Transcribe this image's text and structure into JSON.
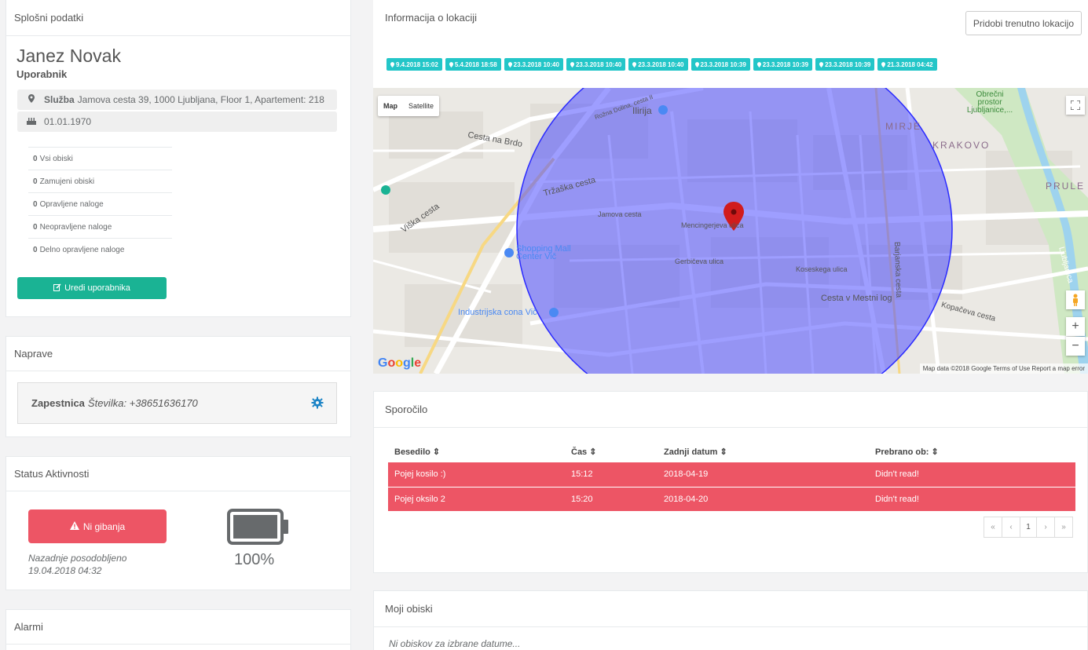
{
  "general": {
    "title": "Splošni podatki",
    "name": "Janez Novak",
    "role": "Uporabnik",
    "address_label": "Služba",
    "address": "Jamova cesta 39, 1000 Ljubljana, Floor 1, Apartement: 218",
    "birthdate": "01.01.1970",
    "stats": [
      {
        "count": "0",
        "label": "Vsi obiski"
      },
      {
        "count": "0",
        "label": "Zamujeni obiski"
      },
      {
        "count": "0",
        "label": "Opravljene naloge"
      },
      {
        "count": "0",
        "label": "Neopravljene naloge"
      },
      {
        "count": "0",
        "label": "Delno opravljene naloge"
      }
    ],
    "edit_button": "Uredi uporabnika"
  },
  "devices": {
    "title": "Naprave",
    "device_name": "Zapestnica",
    "device_number": "Številka: +38651636170"
  },
  "status": {
    "title": "Status Aktivnosti",
    "alarm_button": "Ni gibanja",
    "last_updated_label": "Nazadnje posodobljeno",
    "last_updated_time": "19.04.2018 04:32",
    "battery_percent": "100%",
    "battery_level": 1.0
  },
  "alarms": {
    "title": "Alarmi"
  },
  "location": {
    "title": "Informacija o lokaciji",
    "current_button": "Pridobi trenutno lokacijo",
    "tags": [
      "9.4.2018 15:02",
      "5.4.2018 18:58",
      "23.3.2018 10:40",
      "23.3.2018 10:40",
      "23.3.2018 10:40",
      "23.3.2018 10:39",
      "23.3.2018 10:39",
      "23.3.2018 10:39",
      "21.3.2018 04:42"
    ],
    "map": {
      "type_map": "Map",
      "type_satellite": "Satellite",
      "footer": "Map data ©2018 Google   Terms of Use   Report a map error",
      "labels": [
        "Ilirija",
        "Tržaška cesta",
        "Cesta na Brdo",
        "Jamova cesta",
        "Mencingerjeva ulica",
        "Gerbičeva ulica",
        "Koseskega ulica",
        "Cesta v Mestni log",
        "Shopping Mall Center Vič",
        "Industrijska cona Vič",
        "MIRJE",
        "KRAKOVO",
        "PRULE",
        "Viška cesta",
        "Barjanska cesta",
        "Kopačeva cesta",
        "Rožna Dolina, cesta II",
        "Obrečni prostor Ljubljanice,...",
        "Ljubljanica"
      ],
      "accent": "#4f4fff"
    }
  },
  "message": {
    "title": "Sporočilo",
    "columns": [
      "Besedilo",
      "Čas",
      "Zadnji datum",
      "Prebrano ob:"
    ],
    "rows": [
      [
        "Pojej kosilo :)",
        "15:12",
        "2018-04-19",
        "Didn't read!"
      ],
      [
        "Pojej oksilo 2",
        "15:20",
        "2018-04-20",
        "Didn't read!"
      ]
    ],
    "pager": [
      "«",
      "‹",
      "1",
      "›",
      "»"
    ]
  },
  "visits": {
    "title": "Moji obiski",
    "empty": "Ni obiskov za izbrane datume..."
  }
}
